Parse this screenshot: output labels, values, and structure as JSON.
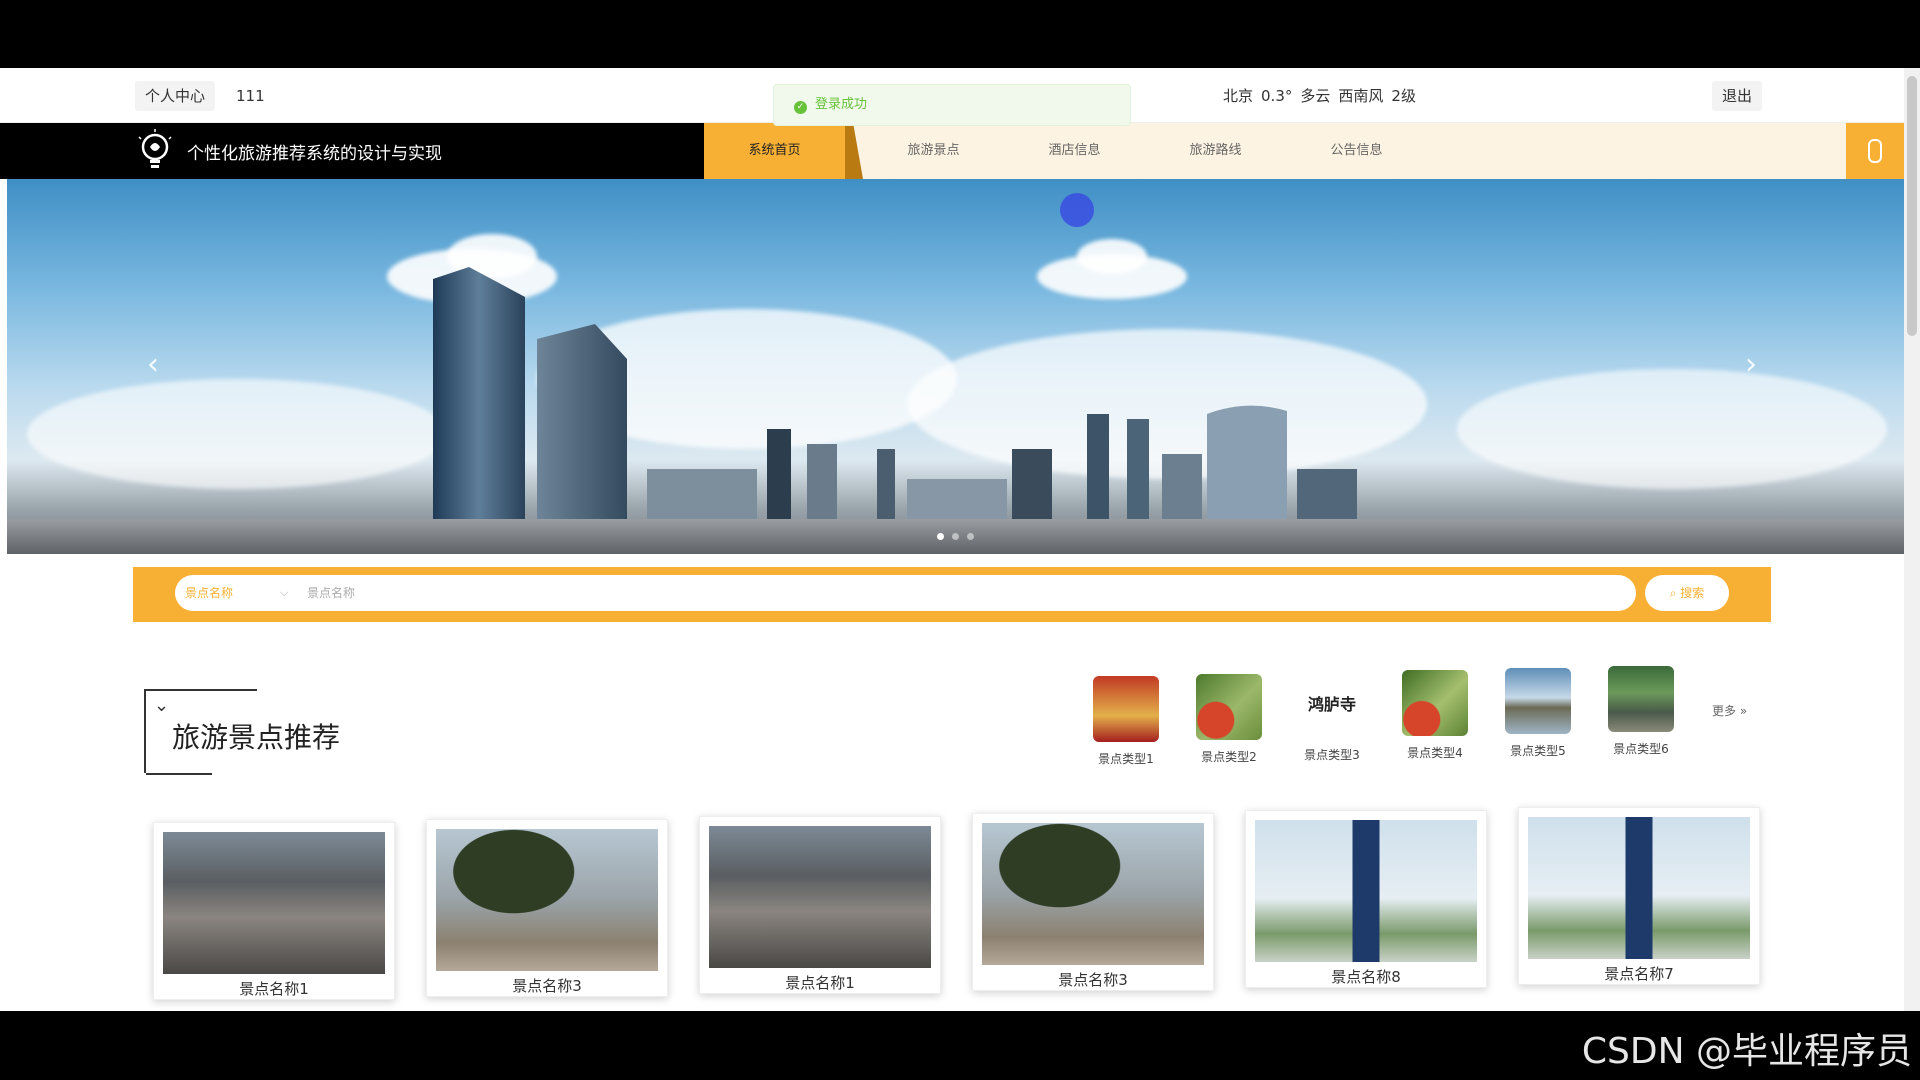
{
  "topbar": {
    "personal_center": "个人中心",
    "username": "111",
    "logout": "退出",
    "weather": {
      "city": "北京",
      "temp": "0.3°",
      "condition": "多云",
      "wind": "西南风",
      "level": "2级"
    }
  },
  "toast": {
    "message": "登录成功"
  },
  "nav": {
    "brand": "个性化旅游推荐系统的设计与实现",
    "items": [
      {
        "label": "系统首页"
      },
      {
        "label": "旅游景点"
      },
      {
        "label": "酒店信息"
      },
      {
        "label": "旅游路线"
      },
      {
        "label": "公告信息"
      }
    ]
  },
  "banner": {
    "slide_count": 3,
    "active_slide": 1,
    "prev_icon": "chevron-left-icon",
    "next_icon": "chevron-right-icon"
  },
  "search": {
    "select_value": "景点名称",
    "placeholder": "景点名称",
    "button_label": "搜索"
  },
  "section": {
    "title": "旅游景点推荐",
    "more_label": "更多"
  },
  "categories": [
    {
      "label": "景点类型1"
    },
    {
      "label": "景点类型2"
    },
    {
      "label": "景点类型3"
    },
    {
      "label": "景点类型4"
    },
    {
      "label": "景点类型5"
    },
    {
      "label": "景点类型6"
    }
  ],
  "category_3_text": "鸿胪寺",
  "cards": [
    {
      "name": "景点名称1"
    },
    {
      "name": "景点名称3"
    },
    {
      "name": "景点名称1"
    },
    {
      "name": "景点名称3"
    },
    {
      "name": "景点名称8"
    },
    {
      "name": "景点名称7"
    }
  ],
  "watermark": "CSDN @毕业程序员",
  "colors": {
    "accent": "#f8b034",
    "nav_bg": "#000000",
    "toast_green": "#67c23a"
  }
}
